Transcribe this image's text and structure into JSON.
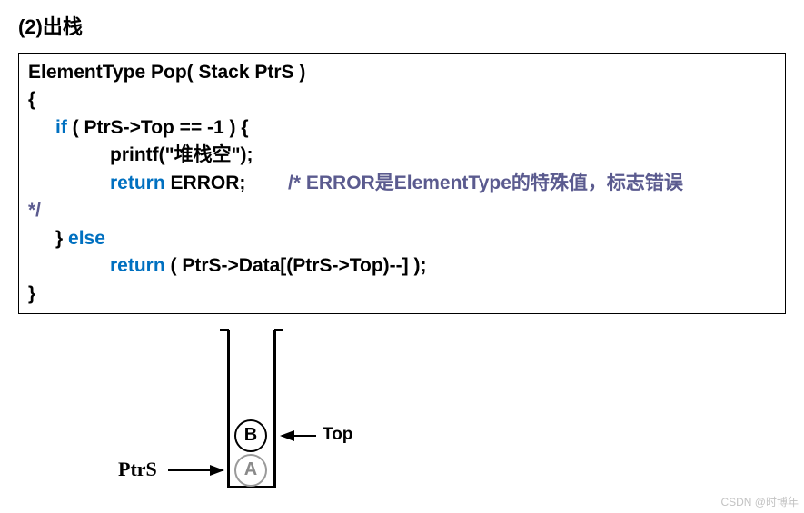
{
  "heading": "(2)出栈",
  "code": {
    "line1": {
      "sig": "ElementType Pop( Stack PtrS )"
    },
    "line2": "{",
    "line3": {
      "kw": "if",
      "rest": " ( PtrS->Top == -1 ) {"
    },
    "line4": "printf(\"堆栈空\");",
    "line5": {
      "kw": "return",
      "rest": " ERROR;",
      "comment": "/* ERROR是ElementType的特殊值，标志错误"
    },
    "line6": {
      "comment": "*/"
    },
    "line7": {
      "close": "} ",
      "kw": "else"
    },
    "line8": {
      "kw": "return",
      "rest": " ( PtrS->Data[(PtrS->Top)--] );"
    },
    "line9": "}"
  },
  "diagram": {
    "ptrs_label": "PtrS",
    "top_label": "Top",
    "node_b": "B",
    "node_a": "A"
  },
  "watermark": "CSDN @时博年"
}
